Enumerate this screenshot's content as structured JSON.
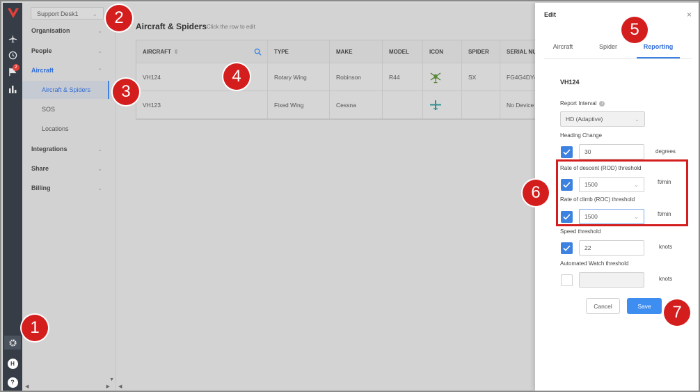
{
  "sidebar": {
    "workspace": "Support Desk1",
    "nav": [
      {
        "label": "Organisation",
        "chevron": "⌄"
      },
      {
        "label": "People",
        "chevron": "⌄"
      },
      {
        "label": "Aircraft",
        "chevron": "⌃"
      },
      {
        "label": "Integrations",
        "chevron": "⌄"
      },
      {
        "label": "Share",
        "chevron": "⌄"
      },
      {
        "label": "Billing",
        "chevron": "⌄"
      }
    ],
    "aircraft_sub": [
      "Aircraft & Spiders",
      "SOS",
      "Locations"
    ]
  },
  "rail": {
    "notification_count": "2",
    "avatar_initial": "H",
    "help": "?",
    "icons": [
      "plane-icon",
      "history-icon",
      "flag-icon",
      "bar-chart-icon",
      "gear-icon",
      "avatar",
      "help-icon"
    ]
  },
  "main": {
    "title": "Aircraft & Spiders",
    "hint": "Click the row to edit",
    "columns": [
      "AIRCRAFT",
      "TYPE",
      "MAKE",
      "MODEL",
      "ICON",
      "SPIDER",
      "SERIAL NU"
    ],
    "sort_glyph": "⇕",
    "rows": [
      {
        "aircraft": "VH124",
        "type": "Rotary Wing",
        "make": "Robinson",
        "model": "R44",
        "icon": "helicopter-icon",
        "spider": "SX",
        "serial": "FG4G4DY4"
      },
      {
        "aircraft": "VH123",
        "type": "Fixed Wing",
        "make": "Cessna",
        "model": "",
        "icon": "airplane-icon",
        "spider": "",
        "serial": "No Device A"
      }
    ]
  },
  "drawer": {
    "title": "Edit",
    "close": "×",
    "tabs": [
      "Aircraft",
      "Spider",
      "Reporting"
    ],
    "active_tab": "Reporting",
    "registration": "VH124",
    "report_interval_label": "Report Interval",
    "report_interval_value": "HD (Adaptive)",
    "heading_change_label": "Heading Change",
    "heading_change_value": "30",
    "heading_change_unit": "degrees",
    "rod_label": "Rate of descent (ROD) threshold",
    "rod_value": "1500",
    "rod_unit": "ft/min",
    "roc_label": "Rate of climb (ROC) threshold",
    "roc_value": "1500",
    "roc_unit": "ft/min",
    "speed_label": "Speed threshold",
    "speed_value": "22",
    "speed_unit": "knots",
    "watch_label": "Automated Watch threshold",
    "watch_value": "",
    "watch_unit": "knots",
    "cancel_label": "Cancel",
    "save_label": "Save"
  },
  "callouts": [
    "1",
    "2",
    "3",
    "4",
    "5",
    "6",
    "7"
  ],
  "colors": {
    "accent": "#3d82e0",
    "callout": "#d41e1e",
    "rail": "#363d47"
  }
}
